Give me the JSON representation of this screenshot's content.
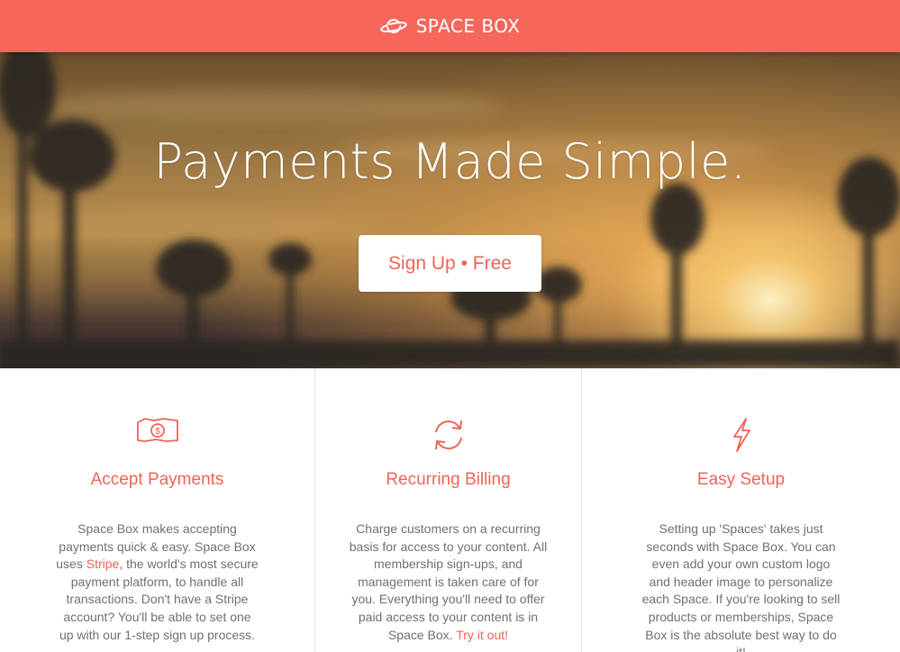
{
  "header": {
    "brand_name": "SPACE BOX",
    "logo_icon": "planet-icon",
    "background": "#f4675a"
  },
  "hero": {
    "title": "Payments Made Simple.",
    "cta_label": "Sign Up • Free"
  },
  "features": [
    {
      "icon": "money-icon",
      "title": "Accept Payments",
      "text_before": "Space Box makes accepting payments quick & easy. Space Box uses ",
      "link_label": "Stripe",
      "text_after": ", the world's most secure payment platform, to handle all transactions. Don't have a Stripe account? You'll be able to set one up with our 1-step sign up process."
    },
    {
      "icon": "refresh-icon",
      "title": "Recurring Billing",
      "text_before": "Charge customers on a recurring basis for access to your content. All membership sign-ups, and management is taken care of for you. Everything you'll need to offer paid access to your content is in Space Box. ",
      "link_label": "Try it out!",
      "text_after": ""
    },
    {
      "icon": "lightning-icon",
      "title": "Easy Setup",
      "text": "Setting up 'Spaces' takes just seconds with Space Box. You can even add your own custom logo and header image to personalize each Space. If you're looking to sell products or memberships, Space Box is the absolute best way to do it!"
    }
  ],
  "colors": {
    "accent": "#ef6356",
    "body_text": "#707070",
    "divider": "#e2e2e2"
  }
}
